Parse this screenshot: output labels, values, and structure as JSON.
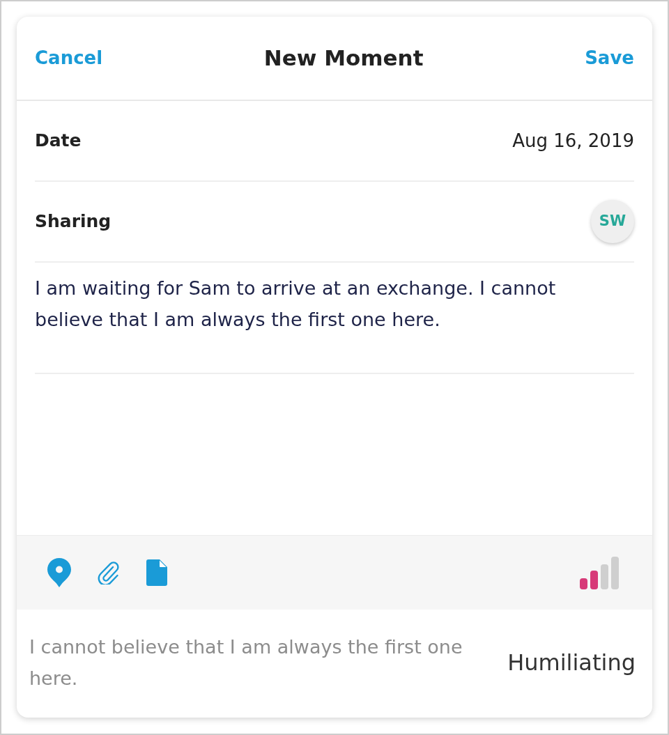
{
  "header": {
    "cancel": "Cancel",
    "title": "New Moment",
    "save": "Save"
  },
  "fields": [
    {
      "kind": "text",
      "label": "Date",
      "value": "Aug 16, 2019"
    },
    {
      "kind": "avatar",
      "label": "Sharing",
      "value": "SW"
    }
  ],
  "moment_text": "I am waiting for Sam to arrive at an exchange. I cannot believe that I am always the first one here.",
  "toolbar": {
    "intensity": {
      "level": 0.5
    }
  },
  "summary": {
    "text": "I cannot believe that I am always the first one here.",
    "feeling": "Humiliating"
  }
}
